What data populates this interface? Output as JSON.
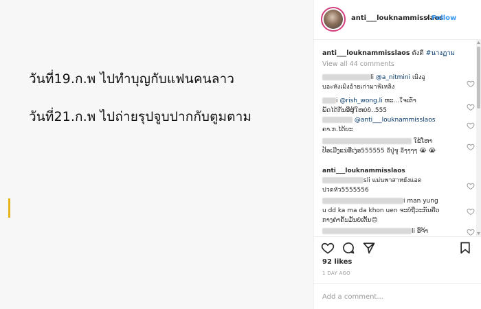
{
  "post": {
    "line1": "วันที่19.ก.พ  ไปทำบุญกับแฟนคนลาว",
    "line2": "วันที่21.ก.พ  ไปถ่ายรุปจูบปากกับตูมตาม",
    "caret_color": "#e6b31e"
  },
  "header": {
    "username": "anti___louknammisslaos",
    "dot": "•",
    "follow_label": "Follow",
    "follow_color": "#3897f0"
  },
  "caption": {
    "username": "anti___louknammisslaos",
    "text": "ดังดี",
    "hashtag": "#นางฏาม"
  },
  "view_all": "View all 44 comments",
  "comments": [
    {
      "username_suffix": "li",
      "mention": "@a_nitmini",
      "text_a": " เมิงอู",
      "text_b": "บอะหังเมิงอ้ายเก่ามาฟ้เหลิง"
    },
    {
      "username_suffix": "i",
      "mention": "@rish_wong.li",
      "text_a": " ຫະ...ໃຈເຕົ່າ",
      "text_b": "ພັດໄດ້ກັນອີ່ຜູ້ໃຫຍ່ບໍ..555"
    },
    {
      "mention": "@anti___louknammisslaos",
      "text_b": "ຄາ.ກ.ໄດ້ບະ"
    },
    {
      "text_a": "ໃຂ້ໂຫາ",
      "text_b": "ປ້ອເມີງແນ່ອີ່ເງ່ອ555555 อีปู่ชู อีๆๆๆๆ 😭 😭"
    },
    {
      "username": "anti___louknammisslaos",
      "username_suffix": "sli",
      "text_a": " แม่นพาสาหยังแอด",
      "text_b": "ปวดหัว5555556"
    },
    {
      "username_suffix": "i",
      "text_a": " man yung",
      "text_b": "u dd ka ma da khon uen ຈະບໍ່ຖືວະກັນຄືດ",
      "text_c": "ກາງຄຳຄັ້ນມັ້ນບໍ່ເຕັ້ນ😊"
    },
    {
      "username_suffix": "li",
      "text_a": " ອີ່ຈ້າ"
    }
  ],
  "likes": "92 likes",
  "time_ago": "1 DAY AGO",
  "add_comment_placeholder": "Add a comment..."
}
